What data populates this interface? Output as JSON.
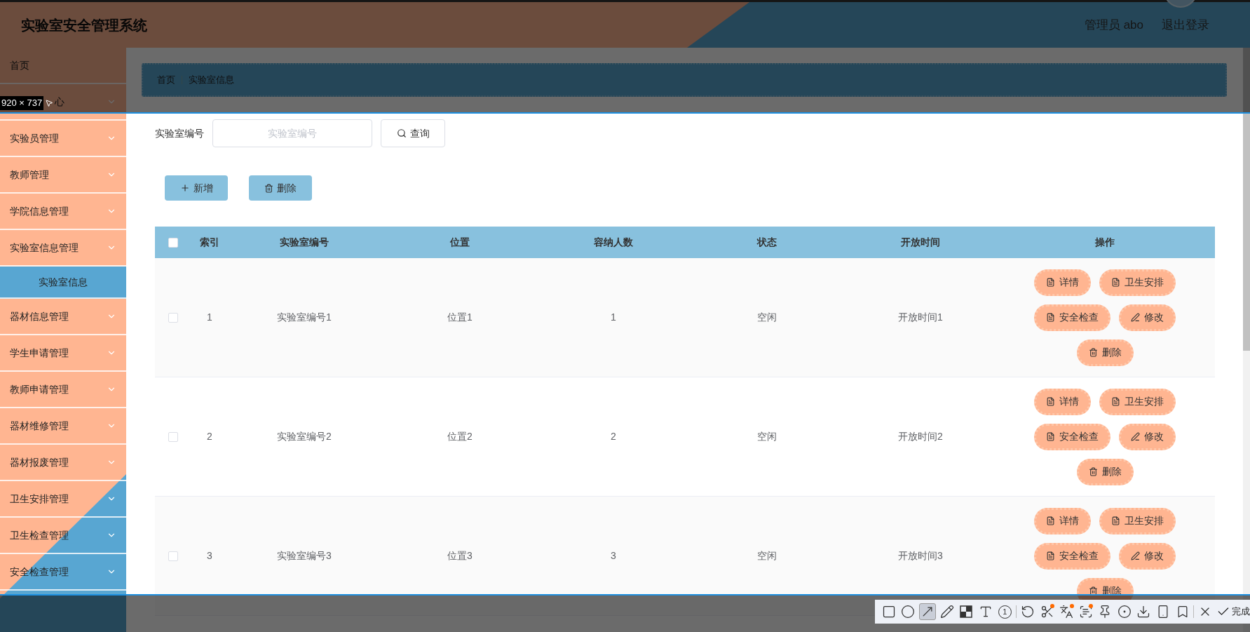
{
  "header": {
    "title": "实验室安全管理系统",
    "user": "管理员 abo",
    "logout": "退出登录"
  },
  "sidebar": {
    "items": [
      {
        "label": "首页",
        "kind": "link"
      },
      {
        "label": "心",
        "kind": "menu"
      },
      {
        "label": "实验员管理",
        "kind": "menu"
      },
      {
        "label": "教师管理",
        "kind": "menu"
      },
      {
        "label": "学院信息管理",
        "kind": "menu"
      },
      {
        "label": "实验室信息管理",
        "kind": "menu",
        "children": [
          {
            "label": "实验室信息",
            "selected": true
          }
        ]
      },
      {
        "label": "器材信息管理",
        "kind": "menu"
      },
      {
        "label": "学生申请管理",
        "kind": "menu"
      },
      {
        "label": "教师申请管理",
        "kind": "menu"
      },
      {
        "label": "器材维修管理",
        "kind": "menu"
      },
      {
        "label": "器材报废管理",
        "kind": "menu"
      },
      {
        "label": "卫生安排管理",
        "kind": "menu"
      },
      {
        "label": "卫生检查管理",
        "kind": "menu"
      },
      {
        "label": "安全检查管理",
        "kind": "menu"
      }
    ]
  },
  "breadcrumb": [
    "首页",
    "实验室信息"
  ],
  "search": {
    "label": "实验室编号",
    "placeholder": "实验室编号",
    "button": "查询"
  },
  "actions": [
    {
      "kind": "add",
      "label": "新增"
    },
    {
      "kind": "delete",
      "label": "删除"
    }
  ],
  "table": {
    "header_checked": false,
    "columns": [
      "索引",
      "实验室编号",
      "位置",
      "容纳人数",
      "状态",
      "开放时间",
      "操作"
    ],
    "rows": [
      {
        "checked": false,
        "cells": [
          "1",
          "实验室编号1",
          "位置1",
          "1",
          "空闲",
          "开放时间1"
        ],
        "actions": [
          {
            "kind": "doc",
            "label": "详情"
          },
          {
            "kind": "doc",
            "label": "卫生安排"
          },
          {
            "kind": "doc",
            "label": "安全检查"
          },
          {
            "kind": "edit",
            "label": "修改"
          },
          {
            "kind": "delete",
            "label": "删除"
          }
        ]
      },
      {
        "checked": false,
        "cells": [
          "2",
          "实验室编号2",
          "位置2",
          "2",
          "空闲",
          "开放时间2"
        ],
        "actions": [
          {
            "kind": "doc",
            "label": "详情"
          },
          {
            "kind": "doc",
            "label": "卫生安排"
          },
          {
            "kind": "doc",
            "label": "安全检查"
          },
          {
            "kind": "edit",
            "label": "修改"
          },
          {
            "kind": "delete",
            "label": "删除"
          }
        ]
      },
      {
        "checked": false,
        "cells": [
          "3",
          "实验室编号3",
          "位置3",
          "3",
          "空闲",
          "开放时间3"
        ],
        "actions": [
          {
            "kind": "doc",
            "label": "详情"
          },
          {
            "kind": "doc",
            "label": "卫生安排"
          },
          {
            "kind": "doc",
            "label": "安全检查"
          },
          {
            "kind": "edit",
            "label": "修改"
          },
          {
            "kind": "delete",
            "label": "删除"
          }
        ]
      }
    ]
  },
  "capture": {
    "size": "920 × 737",
    "number": "1",
    "done": "完成",
    "tools": [
      {
        "kind": "rect",
        "selected": false,
        "badge": false
      },
      {
        "kind": "ellipse",
        "selected": false,
        "badge": false
      },
      {
        "kind": "arrow",
        "selected": true,
        "badge": false
      },
      {
        "kind": "pencil",
        "selected": false,
        "badge": false
      },
      {
        "kind": "mosaic",
        "selected": false,
        "badge": false
      },
      {
        "kind": "text",
        "selected": false,
        "badge": false
      },
      {
        "kind": "number",
        "selected": false,
        "badge": false
      },
      {
        "kind": "sep"
      },
      {
        "kind": "undo",
        "selected": false,
        "badge": false
      },
      {
        "kind": "cut",
        "selected": false,
        "badge": true
      },
      {
        "kind": "translate",
        "selected": false,
        "badge": true
      },
      {
        "kind": "scan",
        "selected": false,
        "badge": true
      },
      {
        "kind": "pin",
        "selected": false,
        "badge": false
      },
      {
        "kind": "record",
        "selected": false,
        "badge": false
      },
      {
        "kind": "download",
        "selected": false,
        "badge": false
      },
      {
        "kind": "phone",
        "selected": false,
        "badge": false
      },
      {
        "kind": "bookmark",
        "selected": false,
        "badge": false
      },
      {
        "kind": "sep"
      },
      {
        "kind": "close",
        "selected": false,
        "badge": false
      }
    ]
  }
}
